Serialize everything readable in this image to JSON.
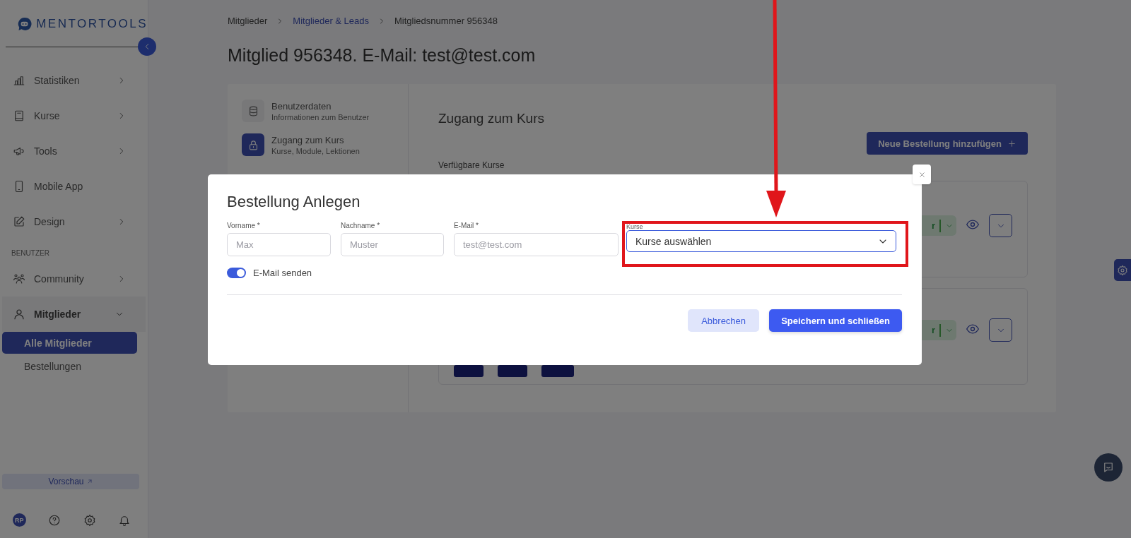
{
  "sidebar": {
    "logo": "MENTORTOOLS",
    "items": [
      {
        "kind": "group",
        "label": "Statistiken",
        "expanded": false
      },
      {
        "kind": "group",
        "label": "Kurse",
        "expanded": false
      },
      {
        "kind": "group",
        "label": "Tools",
        "expanded": false
      },
      {
        "kind": "link",
        "label": "Mobile App"
      },
      {
        "kind": "group",
        "label": "Design",
        "expanded": false
      },
      {
        "kind": "heading",
        "label": "BENUTZER"
      },
      {
        "kind": "group",
        "label": "Community",
        "expanded": false
      },
      {
        "kind": "group",
        "label": "Mitglieder",
        "expanded": true
      },
      {
        "kind": "subitem",
        "label": "Alle Mitglieder",
        "selected": true
      },
      {
        "kind": "subitem",
        "label": "Bestellungen",
        "selected": false
      }
    ],
    "preview": "Vorschau",
    "avatar": "RP"
  },
  "breadcrumb": [
    {
      "label": "Mitglieder",
      "link": false
    },
    {
      "label": "Mitglieder & Leads",
      "link": true
    },
    {
      "label": "Mitgliedsnummer 956348",
      "link": false
    }
  ],
  "page_title": "Mitglied 956348. E-Mail: test@test.com",
  "member_tabs": [
    {
      "title": "Benutzerdaten",
      "subtitle": "Informationen zum Benutzer",
      "selected": false
    },
    {
      "title": "Zugang zum Kurs",
      "subtitle": "Kurse, Module, Lektionen",
      "selected": true
    }
  ],
  "section_title": "Zugang zum Kurs",
  "add_button": "Neue Bestellung hinzufügen",
  "available_label": "Verfügbare Kurse",
  "course_cards": [
    {
      "kind": "plain",
      "badge": "r"
    },
    {
      "kind": "with_modules",
      "badge": "r"
    }
  ],
  "modal": {
    "title": "Bestellung Anlegen",
    "fields": [
      {
        "label": "Vorname *",
        "placeholder": "Max"
      },
      {
        "label": "Nachname *",
        "placeholder": "Muster"
      },
      {
        "label": "E-Mail *",
        "placeholder": "test@test.com"
      }
    ],
    "select": {
      "label": "Kurse",
      "value": "Kurse auswählen"
    },
    "toggle": {
      "label": "E-Mail senden",
      "on": true
    },
    "buttons": [
      {
        "label": "Abbrechen",
        "kind": "secondary"
      },
      {
        "label": "Speichern und schließen",
        "kind": "primary"
      }
    ]
  }
}
